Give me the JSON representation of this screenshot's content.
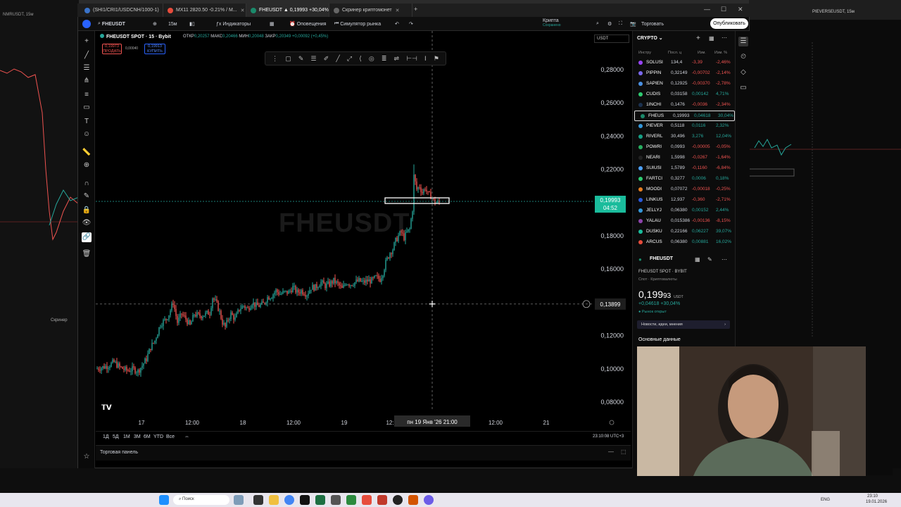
{
  "tabs": [
    {
      "label": "(SHI1/CRI1/USDCNH/1000-1)"
    },
    {
      "label": "MX11 2820.50 -0.21% / M..."
    },
    {
      "label": "FHEUSDT ▲ 0,19993 +30,04%"
    },
    {
      "label": "Скринер криптомонет"
    }
  ],
  "toolbar": {
    "symbol": "FHEUSDT",
    "interval": "15м",
    "indicators": "Индикаторы",
    "alerts": "Оповещения",
    "replay": "Симулятор рынка",
    "layout_name": "Крипта",
    "layout_status": "Сохранено",
    "trade": "Торговать",
    "publish": "Опубликовать"
  },
  "chart": {
    "title": "FHEUSDT SPOT · 15 · Bybit",
    "ohlc": {
      "o_label": "ОТКР",
      "o": "0,20257",
      "h_label": "МАКС",
      "h": "0,20466",
      "l_label": "МИН",
      "l": "0,20048",
      "c_label": "ЗАКР",
      "c": "0,20349",
      "chg": "+0,00092 (+0,45%)"
    },
    "sell_price": "0,19973",
    "sell_label": "ПРОДАТЬ",
    "spread": "0,00040",
    "buy_price": "0,19913",
    "buy_label": "КУПИТЬ",
    "watermark": "FHEUSDT",
    "currency": "USDT",
    "last_price": "0,19993",
    "countdown": "04:52",
    "crosshair_price": "0,13899",
    "crosshair_time": "пн 19 Янв '26   21:00",
    "y_ticks": [
      "0,28000",
      "0,26000",
      "0,24000",
      "0,22000",
      "0,18000",
      "0,16000",
      "0,12000",
      "0,10000",
      "0,08000"
    ],
    "x_ticks": [
      "17",
      "12:00",
      "18",
      "12:00",
      "19",
      "12:",
      "12:00",
      "21"
    ],
    "timeframes": [
      "1Д",
      "5Д",
      "1М",
      "3М",
      "6М",
      "YTD",
      "Все"
    ],
    "clock": "23:10:08 UTC+3",
    "trade_panel": "Торговая панель"
  },
  "watchlist": {
    "title": "CRYPTO",
    "cols": [
      "Инстру",
      "Посл. ц",
      "Изм.",
      "Изм. %"
    ],
    "rows": [
      {
        "sym": "SOLUSI",
        "last": "134,4",
        "chg": "-3,39",
        "pct": "-2,46%",
        "dir": "neg",
        "color": "#9945ff"
      },
      {
        "sym": "PIPPIN",
        "last": "0,32149",
        "chg": "-0,00702",
        "pct": "-2,14%",
        "dir": "neg",
        "color": "#7b68ee"
      },
      {
        "sym": "SAPIEN",
        "last": "0,12925",
        "chg": "-0,00370",
        "pct": "-2,78%",
        "dir": "neg",
        "color": "#4a90e2"
      },
      {
        "sym": "CUDIS",
        "last": "0,03158",
        "chg": "0,00142",
        "pct": "4,71%",
        "dir": "pos",
        "color": "#2ecc71"
      },
      {
        "sym": "1INCHI",
        "last": "0,1476",
        "chg": "-0,0036",
        "pct": "-2,34%",
        "dir": "neg",
        "color": "#1b314f"
      },
      {
        "sym": "FHEUS",
        "last": "0,19993",
        "chg": "0,04618",
        "pct": "30,04%",
        "dir": "pos",
        "color": "#1b8a6b",
        "selected": true
      },
      {
        "sym": "PIEVER",
        "last": "0,5118",
        "chg": "0,0116",
        "pct": "2,32%",
        "dir": "pos",
        "color": "#3498db"
      },
      {
        "sym": "RIVERL",
        "last": "30,496",
        "chg": "3,276",
        "pct": "12,04%",
        "dir": "pos",
        "color": "#16a085"
      },
      {
        "sym": "POWRI",
        "last": "0,0993",
        "chg": "-0,00005",
        "pct": "-0,05%",
        "dir": "neg",
        "color": "#27ae60"
      },
      {
        "sym": "NEARI",
        "last": "1,5998",
        "chg": "-0,0267",
        "pct": "-1,64%",
        "dir": "neg",
        "color": "#222"
      },
      {
        "sym": "SUIUSI",
        "last": "1,5789",
        "chg": "-0,1160",
        "pct": "-6,84%",
        "dir": "neg",
        "color": "#4da2ff"
      },
      {
        "sym": "FARTCI",
        "last": "0,3277",
        "chg": "0,0006",
        "pct": "0,18%",
        "dir": "pos",
        "color": "#2ecc71"
      },
      {
        "sym": "MOODI",
        "last": "0,07072",
        "chg": "-0,00018",
        "pct": "-0,25%",
        "dir": "neg",
        "color": "#e67e22"
      },
      {
        "sym": "LINKUS",
        "last": "12,937",
        "chg": "-0,360",
        "pct": "-2,71%",
        "dir": "neg",
        "color": "#2a5ada"
      },
      {
        "sym": "JELLYJ",
        "last": "0,06380",
        "chg": "0,00152",
        "pct": "2,44%",
        "dir": "pos",
        "color": "#3498db"
      },
      {
        "sym": "YALAU",
        "last": "0,015386",
        "chg": "-0,00136",
        "pct": "-8,15%",
        "dir": "neg",
        "color": "#8e44ad"
      },
      {
        "sym": "DUSKU",
        "last": "0,22166",
        "chg": "0,06227",
        "pct": "39,07%",
        "dir": "pos",
        "color": "#1abc9c"
      },
      {
        "sym": "ARCUS",
        "last": "0,06380",
        "chg": "0,00881",
        "pct": "16,02%",
        "dir": "pos",
        "color": "#e74c3c"
      }
    ]
  },
  "details": {
    "symbol": "FHEUSDT",
    "subtitle": "FHEUSDT SPOT · BYBIT",
    "category": "Спот · Криптовалюты",
    "price_main": "0,199",
    "price_tail": "93",
    "price_ccy": "USDT",
    "change": "+0,04618 +30,04%",
    "market_status": "● Рынок открыт",
    "news": "Новости, идеи, мнения",
    "basic": "Основные данные"
  },
  "taskbar": {
    "search": "Поиск",
    "lang": "ENG",
    "time": "23:10",
    "date": "19.01.2026"
  },
  "bg": {
    "left_title": "NMRUSDT, 15м",
    "screener": "Скринер",
    "right_title": "PIEVERSEUSDT, 15м"
  }
}
